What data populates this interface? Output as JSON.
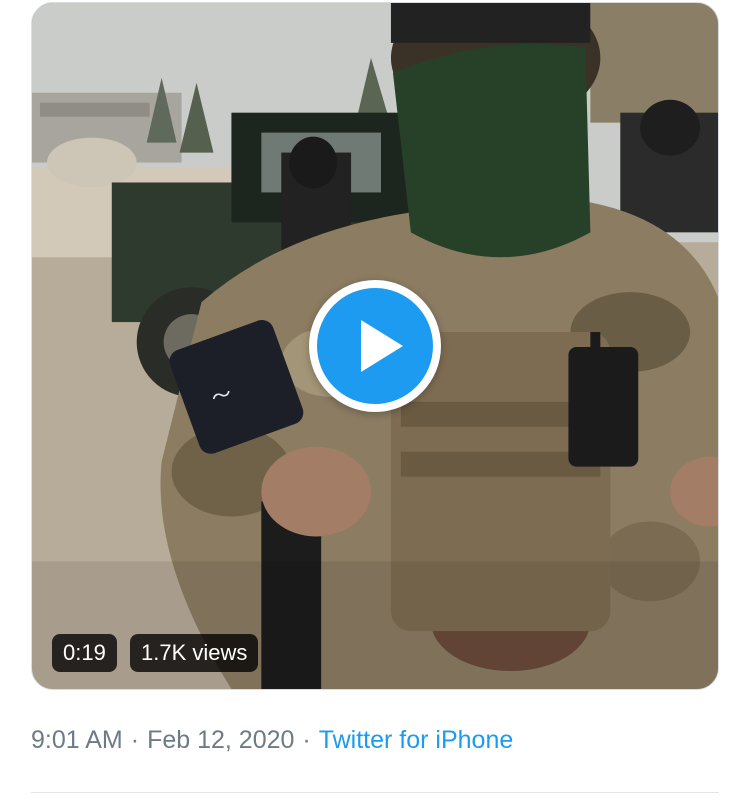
{
  "media": {
    "type": "video",
    "duration": "0:19",
    "views": "1.7K views",
    "play_icon": "play-icon"
  },
  "meta": {
    "time": "9:01 AM",
    "separator": "·",
    "date": "Feb 12, 2020",
    "source": "Twitter for iPhone"
  },
  "colors": {
    "accent": "#1d9bf0",
    "meta_text": "#6e7b86",
    "divider": "#e3e6e9"
  }
}
